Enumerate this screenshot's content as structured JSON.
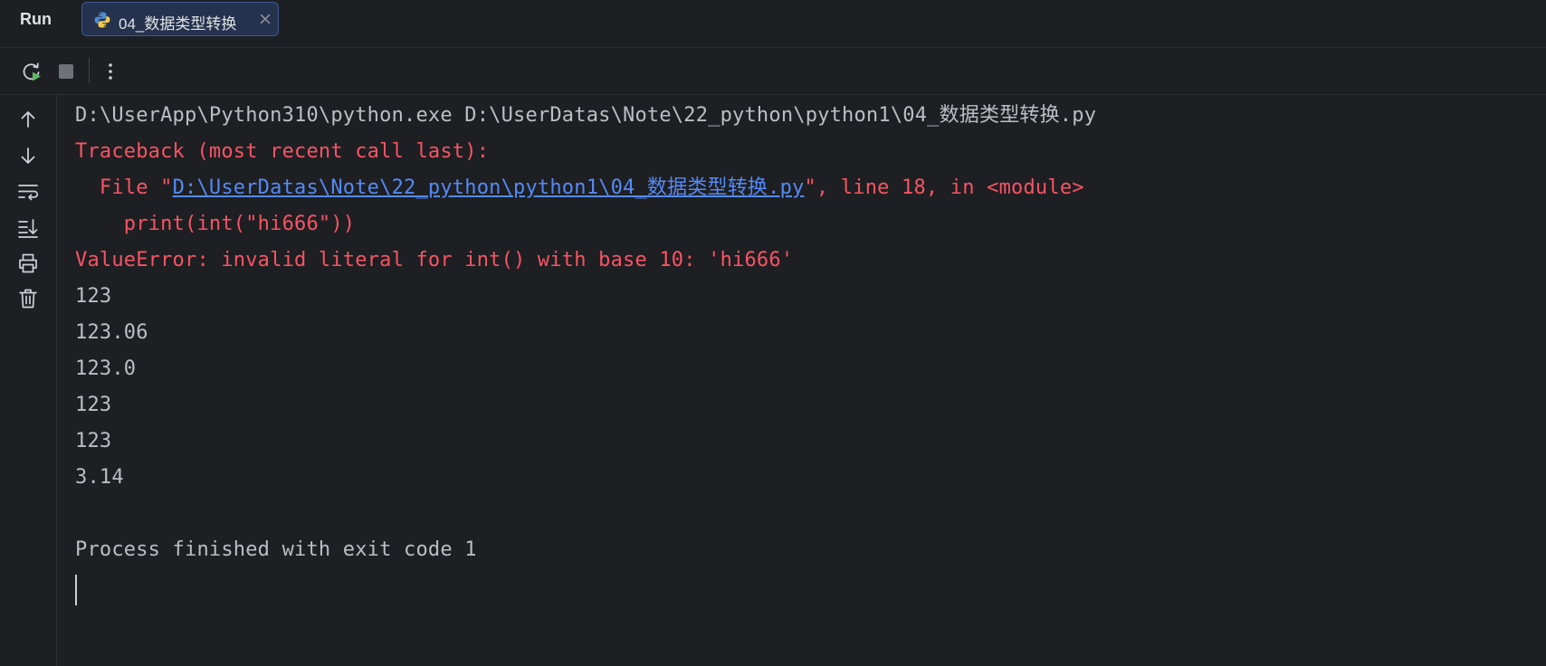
{
  "header": {
    "panel_title": "Run",
    "tab": {
      "label": "04_数据类型转换",
      "icon": "python-icon"
    }
  },
  "toolbar": {
    "buttons": [
      "rerun-icon",
      "stop-icon",
      "more-options-icon"
    ]
  },
  "gutter": {
    "buttons": [
      "scroll-up-icon",
      "scroll-down-icon",
      "soft-wrap-icon",
      "scroll-to-end-icon",
      "print-icon",
      "clear-all-icon"
    ]
  },
  "console": {
    "command_line": "D:\\UserApp\\Python310\\python.exe D:\\UserDatas\\Note\\22_python\\python1\\04_数据类型转换.py",
    "traceback_header": "Traceback (most recent call last):",
    "file_prefix": "  File \"",
    "file_link": "D:\\UserDatas\\Note\\22_python\\python1\\04_数据类型转换.py",
    "file_suffix": "\", line 18, in <module>",
    "code_line": "    print(int(\"hi666\"))",
    "error_line": "ValueError: invalid literal for int() with base 10: 'hi666'",
    "outputs": [
      "123",
      "123.06",
      "123.0",
      "123",
      "123",
      "3.14"
    ],
    "exit_message": "Process finished with exit code 1"
  },
  "colors": {
    "background": "#1e1f22",
    "text": "#bcbec4",
    "error": "#f75464",
    "link": "#548af7",
    "tab_bg": "#25324d",
    "tab_border": "#3b5a94"
  }
}
